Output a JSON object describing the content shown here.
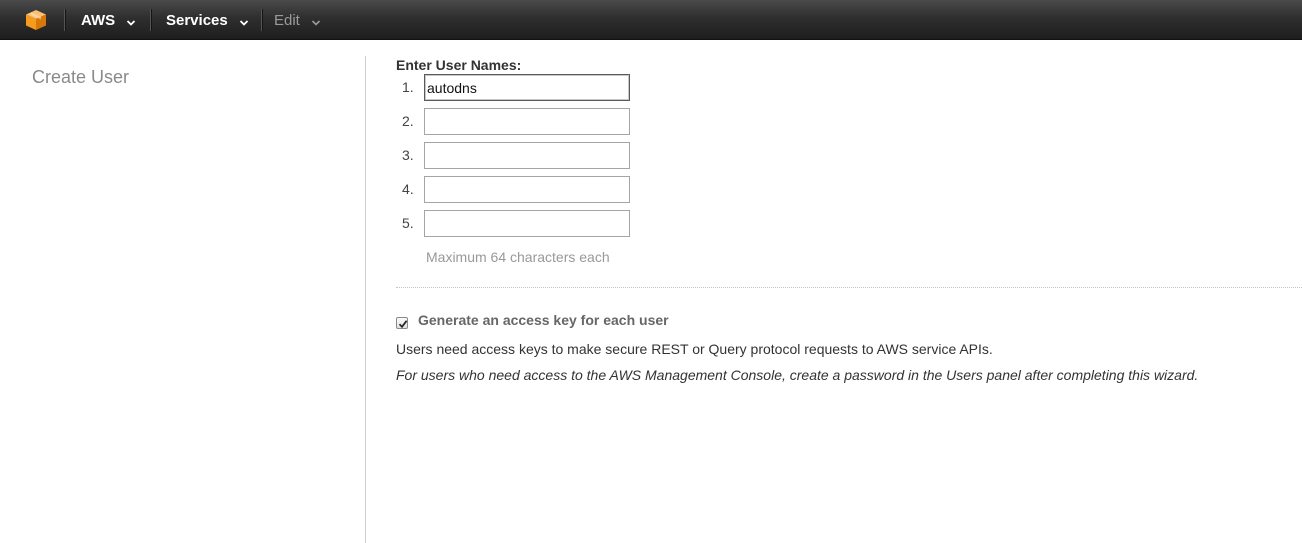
{
  "nav": {
    "logo_icon": "aws-cube-icon",
    "brand_color": "#f79b1e",
    "items": [
      {
        "label": "AWS",
        "icon": "chevron-down-icon"
      },
      {
        "label": "Services",
        "icon": "chevron-down-icon"
      },
      {
        "label": "Edit",
        "icon": "chevron-down-icon"
      }
    ]
  },
  "left_panel": {
    "title": "Create User"
  },
  "form": {
    "label": "Enter User Names:",
    "rows": [
      {
        "num": "1.",
        "value": "autodns"
      },
      {
        "num": "2.",
        "value": ""
      },
      {
        "num": "3.",
        "value": ""
      },
      {
        "num": "4.",
        "value": ""
      },
      {
        "num": "5.",
        "value": ""
      }
    ],
    "hint": "Maximum 64 characters each"
  },
  "access_key": {
    "checked": true,
    "label": "Generate an access key for each user",
    "description": "Users need access keys to make secure REST or Query protocol requests to AWS service APIs.",
    "note": "For users who need access to the AWS Management Console, create a password in the Users panel after completing this wizard."
  }
}
